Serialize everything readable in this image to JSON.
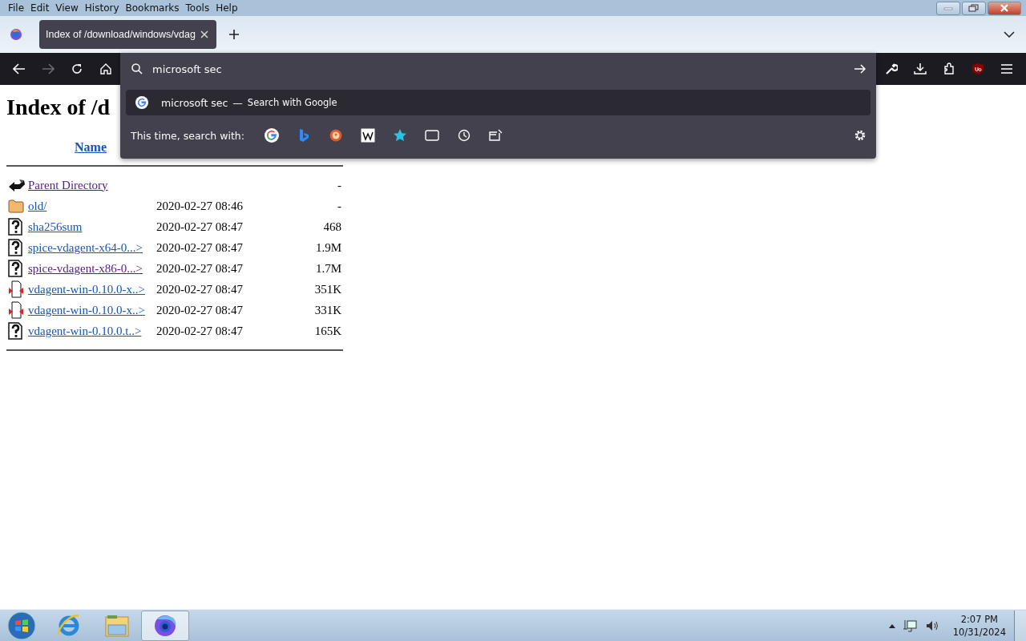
{
  "menu_bar": [
    "File",
    "Edit",
    "View",
    "History",
    "Bookmarks",
    "Tools",
    "Help"
  ],
  "tabs": [
    {
      "title": "Index of /download/windows/vdag",
      "selected": true
    }
  ],
  "nav_buttons": [
    {
      "kind": "back",
      "disabled": false
    },
    {
      "kind": "forward",
      "disabled": true
    },
    {
      "kind": "reload",
      "disabled": false
    },
    {
      "kind": "home",
      "disabled": false
    }
  ],
  "toolbar_buttons": [
    {
      "kind": "wrench"
    },
    {
      "kind": "download"
    },
    {
      "kind": "extensions"
    },
    {
      "kind": "ublock"
    },
    {
      "kind": "menu"
    }
  ],
  "address_bar": {
    "value": "microsoft sec"
  },
  "suggestions": [
    {
      "query": "microsoft sec",
      "separator": "—",
      "action": "Search with Google",
      "selected": true
    }
  ],
  "search_with": {
    "label": "This time, search with:",
    "engines": [
      {
        "kind": "google"
      },
      {
        "kind": "bing"
      },
      {
        "kind": "duckduckgo"
      },
      {
        "kind": "wikipedia"
      },
      {
        "kind": "bookmarks"
      },
      {
        "kind": "tabs"
      },
      {
        "kind": "history"
      },
      {
        "kind": "actions"
      }
    ]
  },
  "page": {
    "heading": "Index of /d",
    "columns": [
      "Name"
    ],
    "rows": [
      {
        "kind": "back",
        "name": "Parent Directory",
        "date": "",
        "size": "-",
        "visited": true
      },
      {
        "kind": "folder",
        "name": "old/",
        "date": "2020-02-27 08:46",
        "size": "-",
        "visited": false
      },
      {
        "kind": "unknown",
        "name": "sha256sum",
        "date": "2020-02-27 08:47",
        "size": "468",
        "visited": false
      },
      {
        "kind": "unknown",
        "name": "spice-vdagent-x64-0...>",
        "date": "2020-02-27 08:47",
        "size": "1.9M",
        "visited": false
      },
      {
        "kind": "unknown",
        "name": "spice-vdagent-x86-0...>",
        "date": "2020-02-27 08:47",
        "size": "1.7M",
        "visited": true
      },
      {
        "kind": "binary",
        "name": "vdagent-win-0.10.0-x..>",
        "date": "2020-02-27 08:47",
        "size": "351K",
        "visited": false
      },
      {
        "kind": "binary",
        "name": "vdagent-win-0.10.0-x..>",
        "date": "2020-02-27 08:47",
        "size": "331K",
        "visited": false
      },
      {
        "kind": "unknown",
        "name": "vdagent-win-0.10.0.t..>",
        "date": "2020-02-27 08:47",
        "size": "165K",
        "visited": false
      }
    ]
  },
  "taskbar": {
    "items": [
      {
        "kind": "ie",
        "selected": false
      },
      {
        "kind": "explorer",
        "selected": false
      },
      {
        "kind": "firefox",
        "selected": true
      }
    ],
    "time": "2:07 PM",
    "date": "10/31/2024"
  }
}
